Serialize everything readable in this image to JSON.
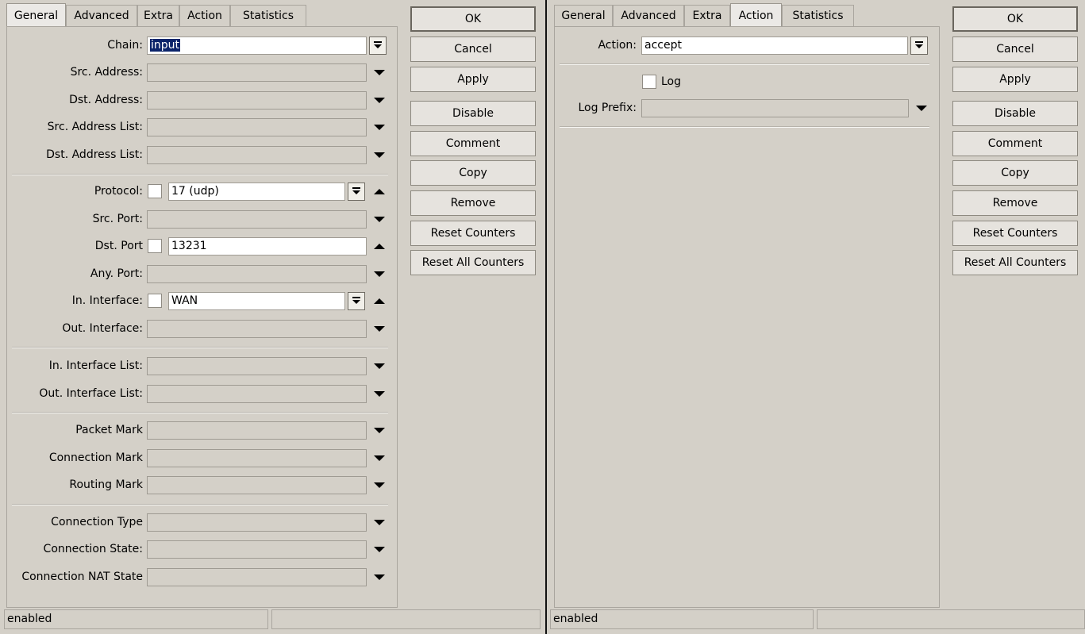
{
  "left": {
    "tabs": [
      "General",
      "Advanced",
      "Extra",
      "Action",
      "Statistics"
    ],
    "active_tab": "General",
    "fields": [
      {
        "label": "Chain:",
        "value": "input",
        "type": "dropdown-selected"
      },
      {
        "label": "Src. Address:",
        "value": "",
        "type": "combo"
      },
      {
        "label": "Dst. Address:",
        "value": "",
        "type": "combo"
      },
      {
        "label": "Src. Address List:",
        "value": "",
        "type": "combo"
      },
      {
        "label": "Dst. Address List:",
        "value": "",
        "type": "combo"
      },
      {
        "label": "Protocol:",
        "value": "17 (udp)",
        "type": "check-dropdown"
      },
      {
        "label": "Src. Port:",
        "value": "",
        "type": "combo"
      },
      {
        "label": "Dst. Port",
        "value": "13231",
        "type": "check-text"
      },
      {
        "label": "Any. Port:",
        "value": "",
        "type": "combo"
      },
      {
        "label": "In. Interface:",
        "value": "WAN",
        "type": "check-dropdown"
      },
      {
        "label": "Out. Interface:",
        "value": "",
        "type": "combo"
      },
      {
        "label": "In. Interface List:",
        "value": "",
        "type": "combo"
      },
      {
        "label": "Out. Interface List:",
        "value": "",
        "type": "combo"
      },
      {
        "label": "Packet Mark",
        "value": "",
        "type": "combo"
      },
      {
        "label": "Connection Mark",
        "value": "",
        "type": "combo"
      },
      {
        "label": "Routing Mark",
        "value": "",
        "type": "combo"
      },
      {
        "label": "Connection Type",
        "value": "",
        "type": "combo"
      },
      {
        "label": "Connection State:",
        "value": "",
        "type": "combo"
      },
      {
        "label": "Connection NAT State",
        "value": "",
        "type": "combo"
      }
    ],
    "status": "enabled",
    "status2": ""
  },
  "right": {
    "tabs": [
      "General",
      "Advanced",
      "Extra",
      "Action",
      "Statistics"
    ],
    "active_tab": "Action",
    "action_label": "Action:",
    "action_value": "accept",
    "log_label": "Log",
    "log_prefix_label": "Log Prefix:",
    "log_prefix_value": "",
    "status": "enabled",
    "status2": ""
  },
  "buttons": [
    "OK",
    "Cancel",
    "Apply",
    "Disable",
    "Comment",
    "Copy",
    "Remove",
    "Reset Counters",
    "Reset All Counters"
  ]
}
